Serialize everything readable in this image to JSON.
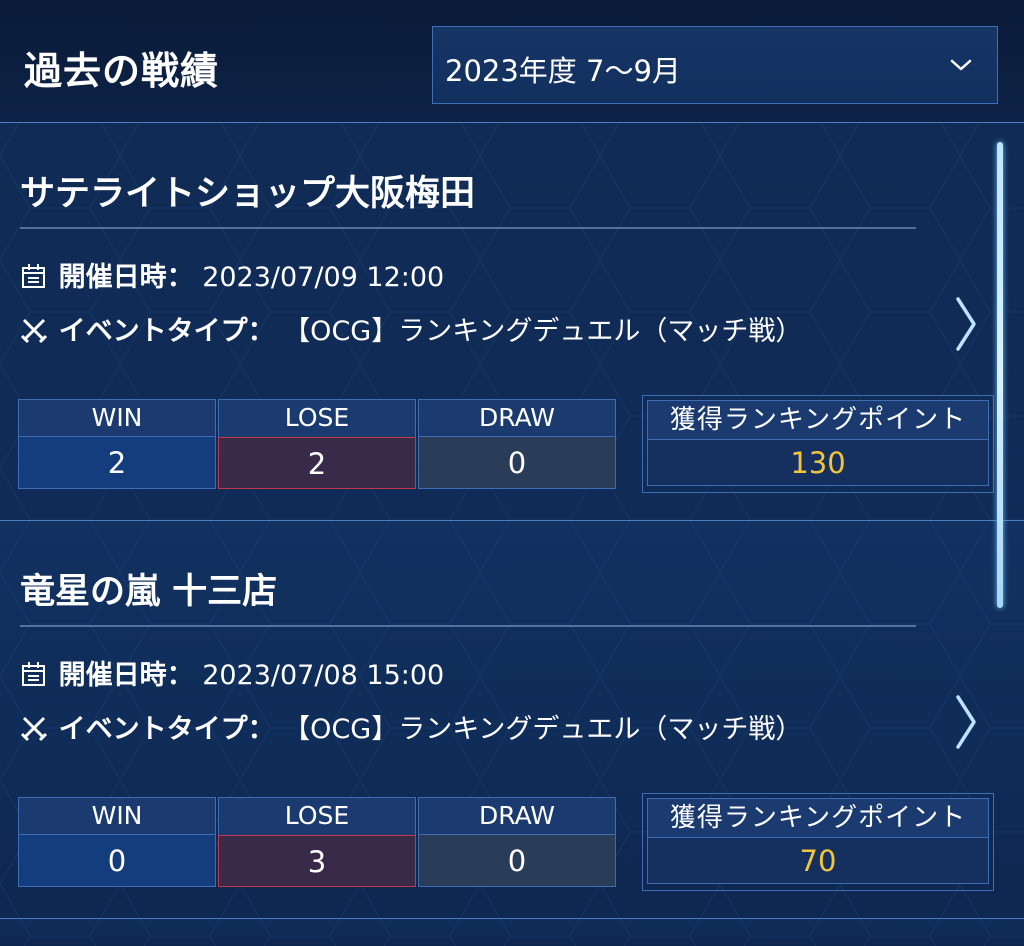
{
  "header": {
    "title": "過去の戦績",
    "period_selected": "2023年度 7〜9月"
  },
  "labels": {
    "date": "開催日時：",
    "event_type": "イベントタイプ：",
    "win": "WIN",
    "lose": "LOSE",
    "draw": "DRAW",
    "points": "獲得ランキングポイント"
  },
  "records": [
    {
      "shop": "サテライトショップ大阪梅田",
      "datetime": "2023/07/09 12:00",
      "event_type": "【OCG】ランキングデュエル（マッチ戦）",
      "win": "2",
      "lose": "2",
      "draw": "0",
      "points": "130"
    },
    {
      "shop": "竜星の嵐 十三店",
      "datetime": "2023/07/08 15:00",
      "event_type": "【OCG】ランキングデュエル（マッチ戦）",
      "win": "0",
      "lose": "3",
      "draw": "0",
      "points": "70"
    }
  ],
  "colors": {
    "background": "#0c1f3f",
    "accent_border": "#3e6db4",
    "points_text": "#f2c53d",
    "lose_border": "#c23a4a"
  },
  "icons": {
    "calendar": "calendar-icon",
    "event_type": "crossed-swords-icon",
    "dropdown": "chevron-down-icon",
    "open_detail": "chevron-right-icon"
  }
}
